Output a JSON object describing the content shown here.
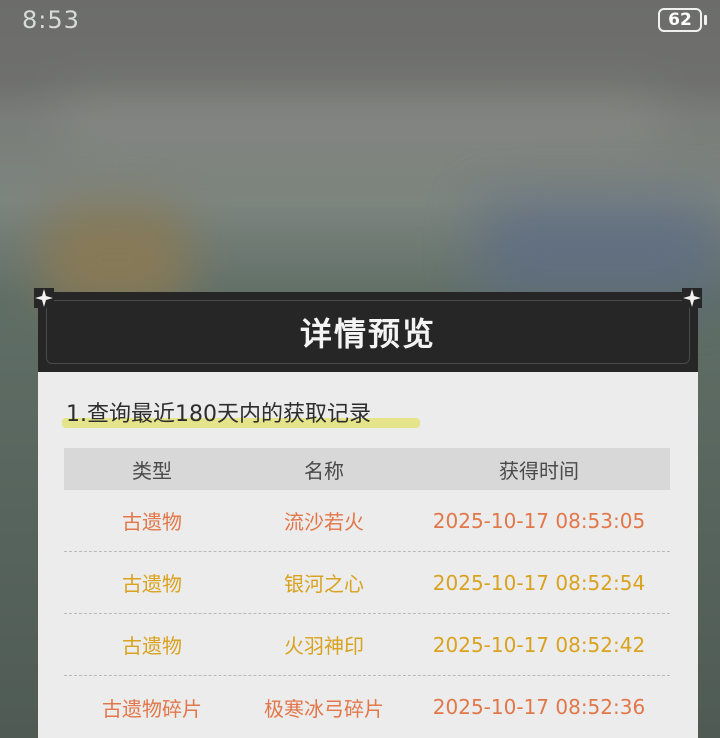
{
  "status_bar": {
    "time": "8:53",
    "battery": "62"
  },
  "dialog": {
    "title": "详情预览",
    "section_title": "1.查询最近180天内的获取记录",
    "columns": [
      "类型",
      "名称",
      "获得时间"
    ],
    "rows": [
      {
        "type": "古遗物",
        "name": "流沙若火",
        "time": "2025-10-17 08:53:05",
        "color": "#e2774a"
      },
      {
        "type": "古遗物",
        "name": "银河之心",
        "time": "2025-10-17 08:52:54",
        "color": "#d9a21f"
      },
      {
        "type": "古遗物",
        "name": "火羽神印",
        "time": "2025-10-17 08:52:42",
        "color": "#d9a21f"
      },
      {
        "type": "古遗物碎片",
        "name": "极寒冰弓碎片",
        "time": "2025-10-17 08:52:36",
        "color": "#e2774a"
      }
    ]
  },
  "colors": {
    "header_bg": "#262626",
    "body_bg": "#ececec",
    "highlight": "#e6e48a"
  }
}
